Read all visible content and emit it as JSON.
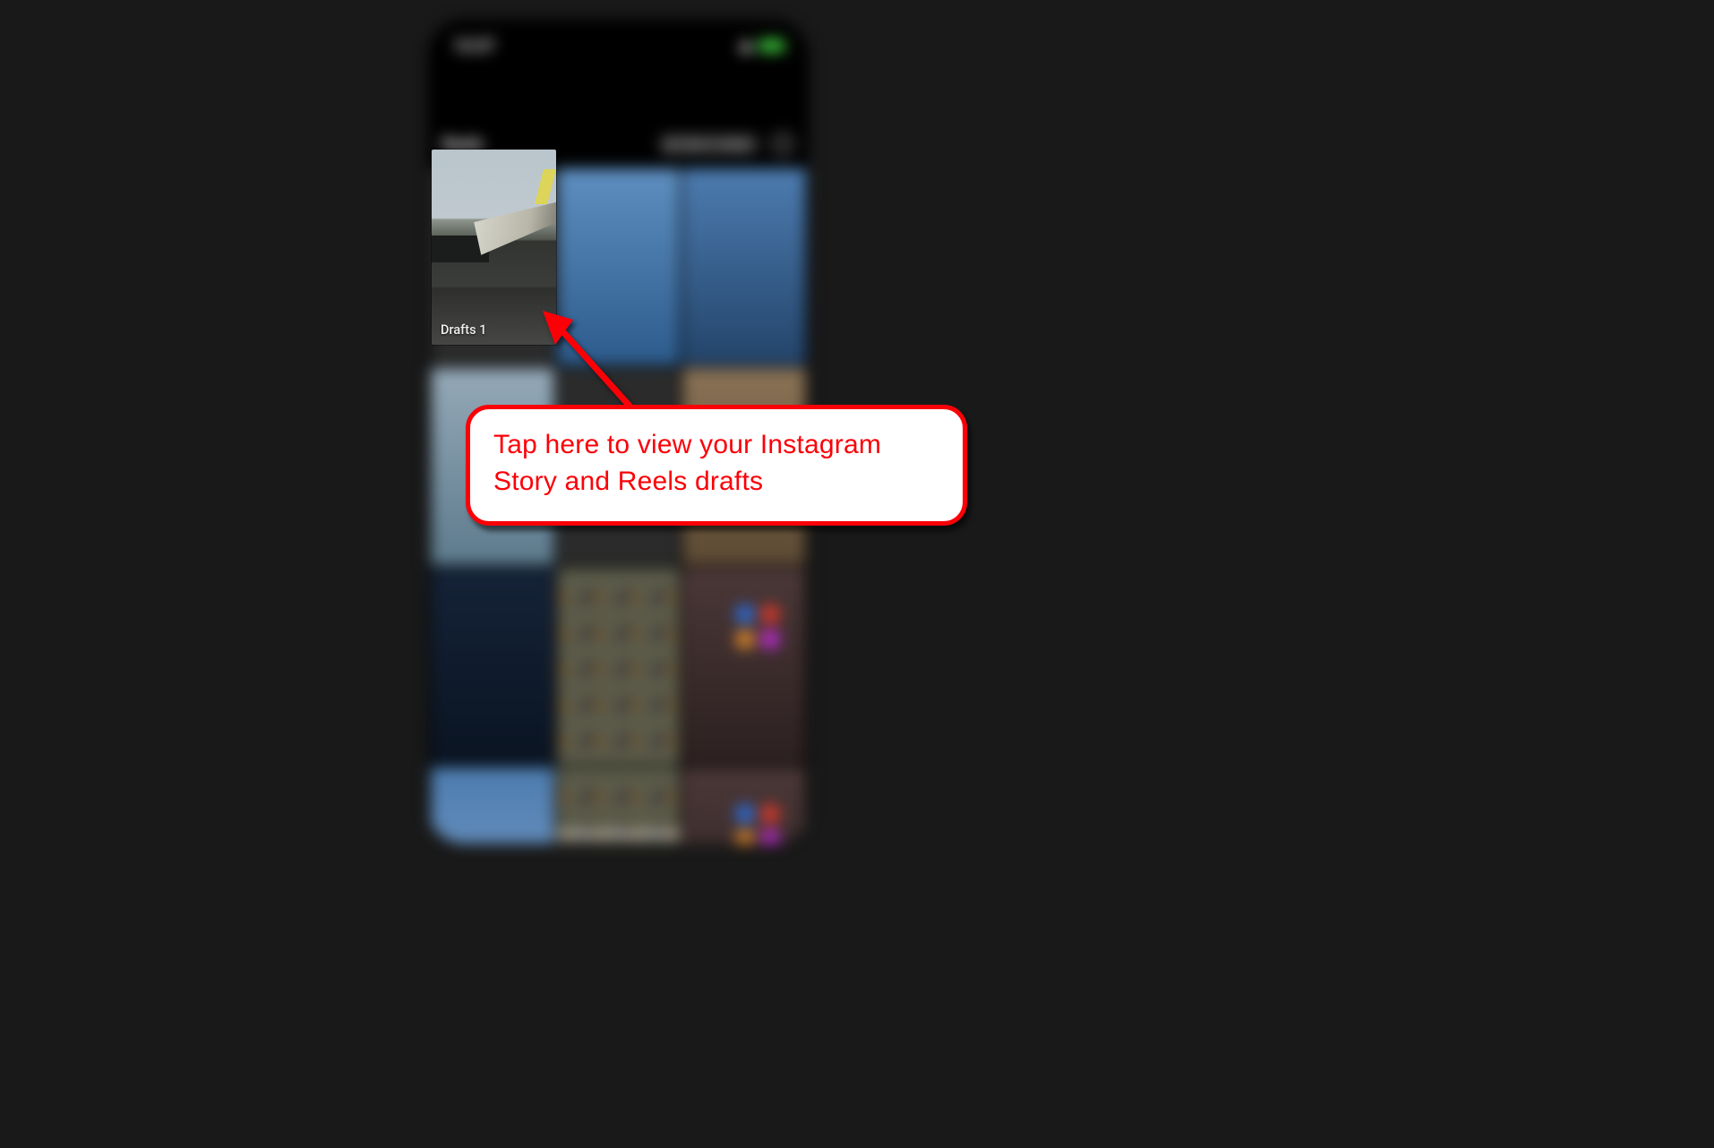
{
  "status_bar": {
    "time": "12:27"
  },
  "app_header": {
    "title": "Reels",
    "select_button": "Select multiple"
  },
  "drafts_tile": {
    "label": "Drafts",
    "count": "1"
  },
  "callout": {
    "text": "Tap here to view your Instagram Story and Reels drafts"
  },
  "annotation_color": "#fb0007"
}
